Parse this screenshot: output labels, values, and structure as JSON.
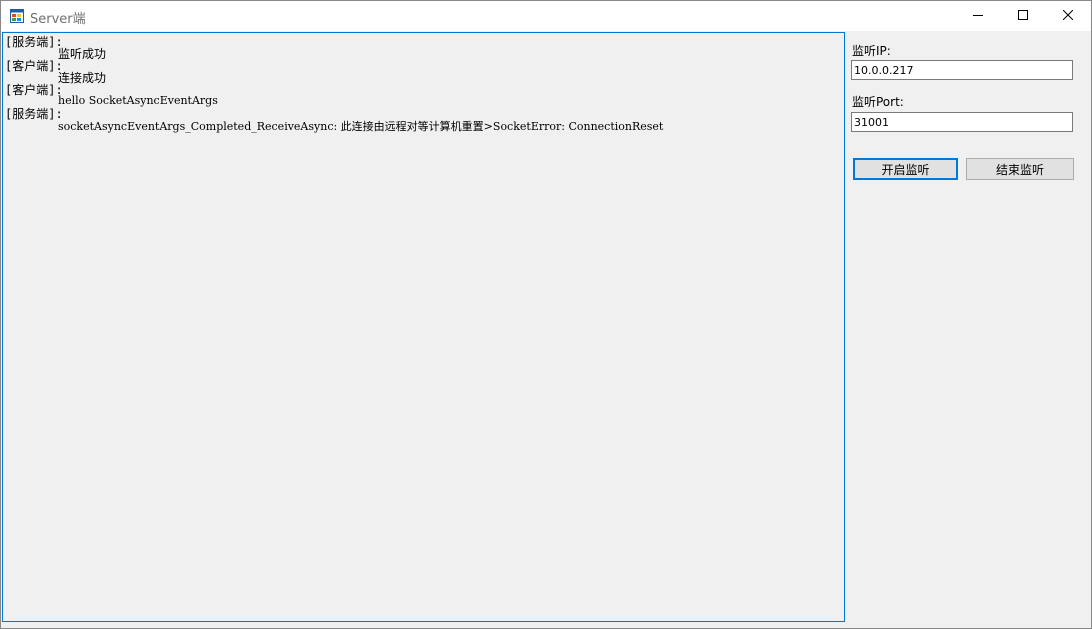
{
  "window": {
    "title": "Server端",
    "icons": {
      "app": "app-window-icon",
      "minimize": "minimize-icon",
      "maximize": "maximize-icon",
      "close": "close-icon"
    }
  },
  "log": {
    "entries": [
      {
        "role": "[服务端]:",
        "message": "监听成功"
      },
      {
        "role": "[客户端]:",
        "message": "连接成功"
      },
      {
        "role": "[客户端]:",
        "message": "hello SocketAsyncEventArgs"
      },
      {
        "role": "[服务端]:",
        "message": "socketAsyncEventArgs_Completed_ReceiveAsync: 此连接由远程对等计算机重置>SocketError: ConnectionReset"
      }
    ]
  },
  "side": {
    "ip_label": "监听IP:",
    "ip_value": "10.0.0.217",
    "port_label": "监听Port:",
    "port_value": "31001",
    "start_button": "开启监听",
    "stop_button": "结束监听"
  },
  "colors": {
    "accent": "#0078d7",
    "background": "#f0f0f0",
    "title_text": "#6f6f6f"
  }
}
